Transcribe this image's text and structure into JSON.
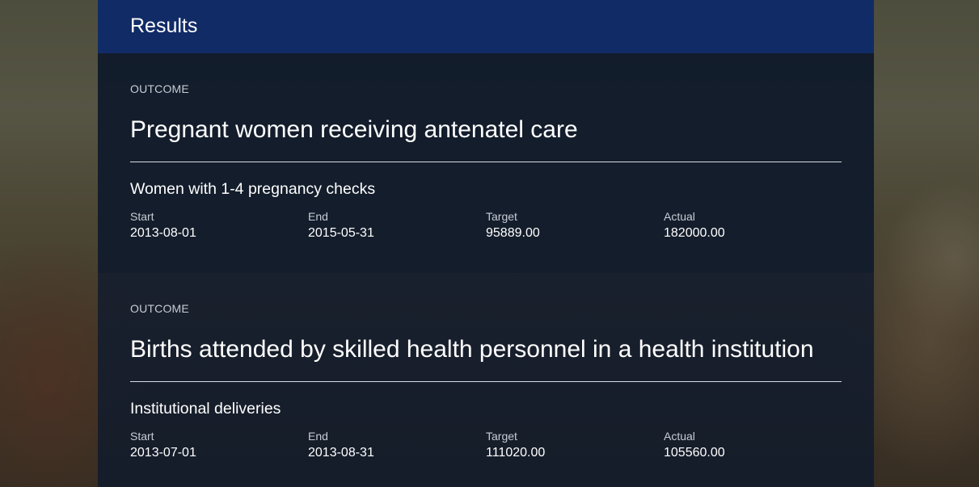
{
  "header": {
    "title": "Results"
  },
  "results": [
    {
      "outcome_label": "OUTCOME",
      "title": "Pregnant women receiving antenatel care",
      "indicator": "Women with 1-4 pregnancy checks",
      "stats": {
        "start_label": "Start",
        "start_value": "2013-08-01",
        "end_label": "End",
        "end_value": "2015-05-31",
        "target_label": "Target",
        "target_value": "95889.00",
        "actual_label": "Actual",
        "actual_value": "182000.00"
      }
    },
    {
      "outcome_label": "OUTCOME",
      "title": "Births attended by skilled health personnel in a health institution",
      "indicator": "Institutional deliveries",
      "stats": {
        "start_label": "Start",
        "start_value": "2013-07-01",
        "end_label": "End",
        "end_value": "2013-08-31",
        "target_label": "Target",
        "target_value": "111020.00",
        "actual_label": "Actual",
        "actual_value": "105560.00"
      }
    }
  ],
  "colors": {
    "header_bg": "#112b66",
    "panel_bg": "#131c2c",
    "text_primary": "#ffffff",
    "text_secondary": "#c7ccd6"
  }
}
